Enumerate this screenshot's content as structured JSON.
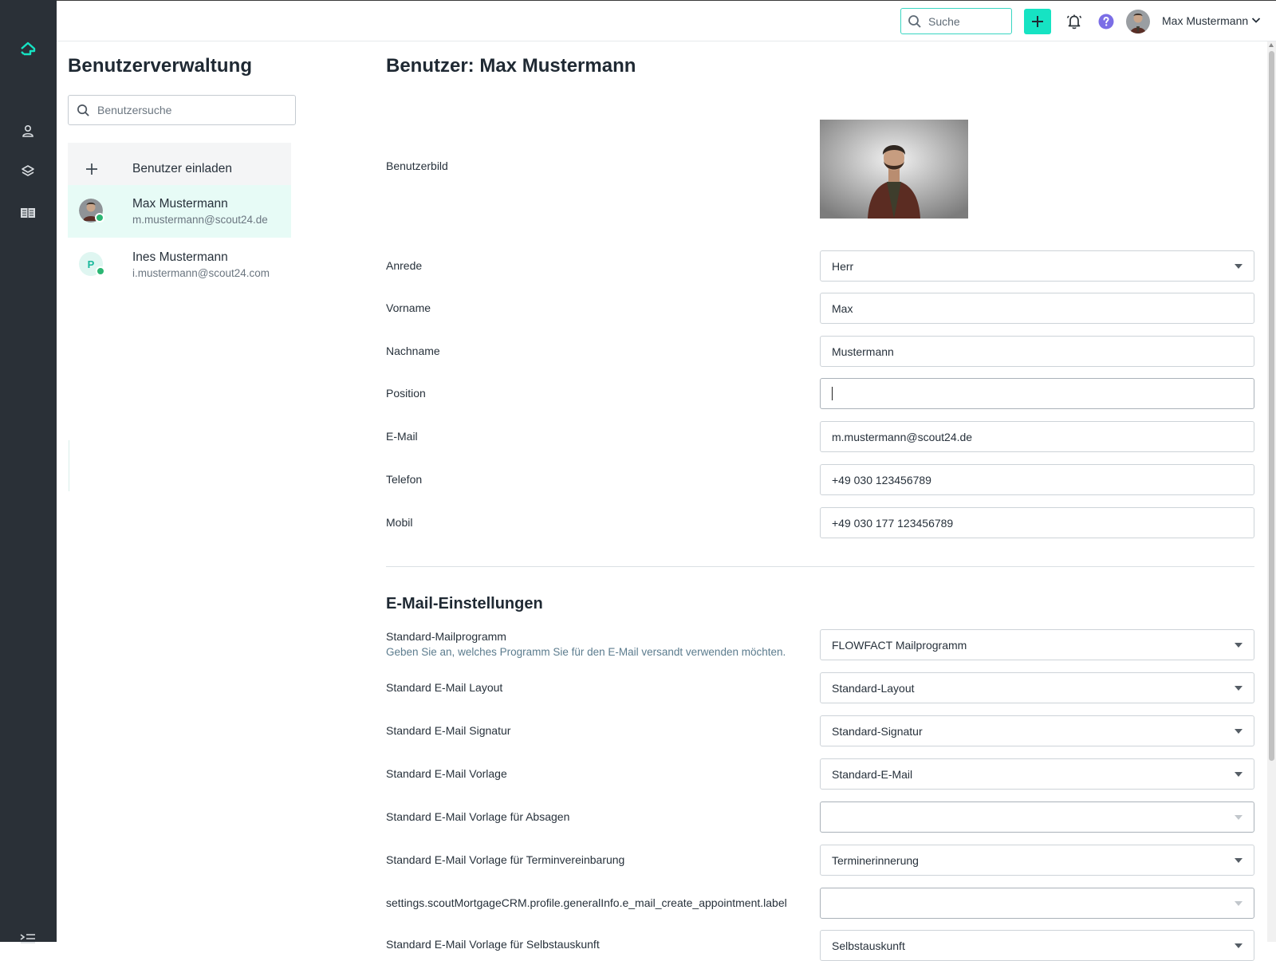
{
  "topbar": {
    "search_placeholder": "Suche",
    "user_name": "Max Mustermann"
  },
  "sidebar": {
    "title": "Benutzerverwaltung",
    "search_placeholder": "Benutzersuche",
    "invite_label": "Benutzer einladen",
    "users": [
      {
        "name": "Max Mustermann",
        "email": "m.mustermann@scout24.de",
        "avatar_initial": ""
      },
      {
        "name": "Ines Mustermann",
        "email": "i.mustermann@scout24.com",
        "avatar_initial": "P"
      }
    ]
  },
  "main": {
    "title": "Benutzer: Max Mustermann",
    "labels": {
      "photo": "Benutzerbild",
      "salutation": "Anrede",
      "first_name": "Vorname",
      "last_name": "Nachname",
      "position": "Position",
      "email": "E-Mail",
      "phone": "Telefon",
      "mobile": "Mobil"
    },
    "values": {
      "salutation": "Herr",
      "first_name": "Max",
      "last_name": "Mustermann",
      "position": "",
      "email": "m.mustermann@scout24.de",
      "phone": "+49 030 123456789",
      "mobile": "+49 030 177 123456789"
    }
  },
  "email_settings": {
    "title": "E-Mail-Einstellungen",
    "rows": [
      {
        "label": "Standard-Mailprogramm",
        "help": "Geben Sie an, welches Programm Sie für den E-Mail versandt verwenden möchten.",
        "value": "FLOWFACT Mailprogramm"
      },
      {
        "label": "Standard E-Mail Layout",
        "value": "Standard-Layout"
      },
      {
        "label": "Standard E-Mail Signatur",
        "value": "Standard-Signatur"
      },
      {
        "label": "Standard E-Mail Vorlage",
        "value": "Standard-E-Mail"
      },
      {
        "label": "Standard E-Mail Vorlage für Absagen",
        "value": ""
      },
      {
        "label": "Standard E-Mail Vorlage für Terminvereinbarung",
        "value": "Terminerinnerung"
      },
      {
        "label": "settings.scoutMortgageCRM.profile.generalInfo.e_mail_create_appointment.label",
        "value": ""
      },
      {
        "label": "Standard E-Mail Vorlage für Selbstauskunft",
        "value": "Selbstauskunft"
      }
    ]
  },
  "colors": {
    "rail": "#2a3037",
    "accent": "#16e3c3",
    "selected_row": "#e7fbf6",
    "help_text": "#5c7c8e"
  }
}
